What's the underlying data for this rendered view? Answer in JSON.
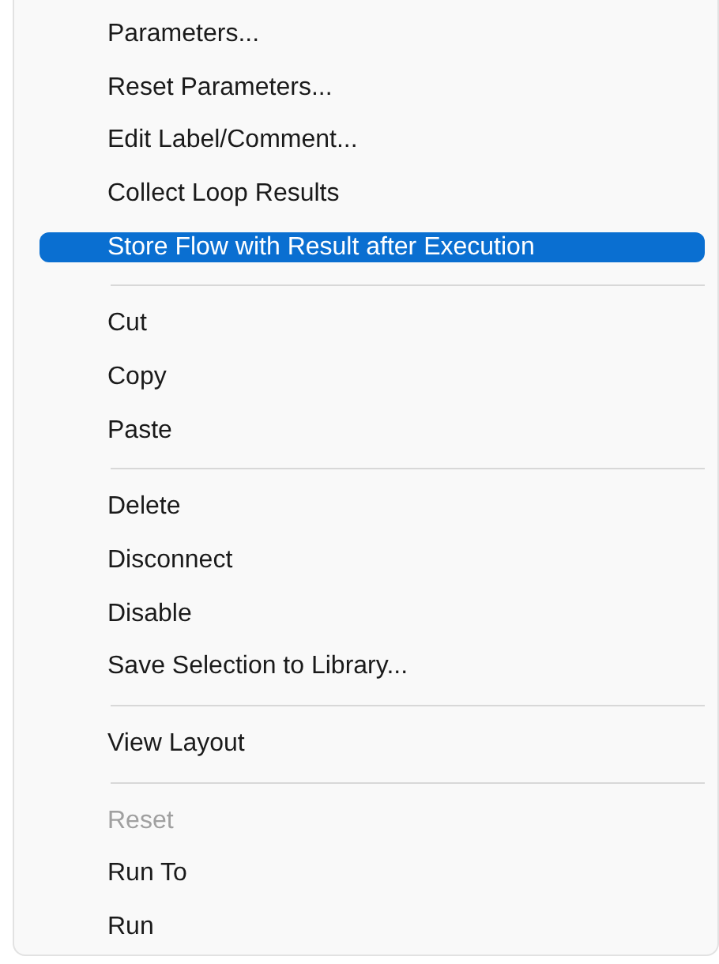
{
  "context_menu": {
    "groups": [
      {
        "items": [
          {
            "label": "Parameters...",
            "selected": false,
            "disabled": false
          },
          {
            "label": "Reset Parameters...",
            "selected": false,
            "disabled": false
          },
          {
            "label": "Edit Label/Comment...",
            "selected": false,
            "disabled": false
          },
          {
            "label": "Collect Loop Results",
            "selected": false,
            "disabled": false
          },
          {
            "label": "Store Flow with Result after Execution",
            "selected": true,
            "disabled": false
          }
        ]
      },
      {
        "items": [
          {
            "label": "Cut",
            "selected": false,
            "disabled": false
          },
          {
            "label": "Copy",
            "selected": false,
            "disabled": false
          },
          {
            "label": "Paste",
            "selected": false,
            "disabled": false
          }
        ]
      },
      {
        "items": [
          {
            "label": "Delete",
            "selected": false,
            "disabled": false
          },
          {
            "label": "Disconnect",
            "selected": false,
            "disabled": false
          },
          {
            "label": "Disable",
            "selected": false,
            "disabled": false
          },
          {
            "label": "Save Selection to Library...",
            "selected": false,
            "disabled": false
          }
        ]
      },
      {
        "items": [
          {
            "label": "View Layout",
            "selected": false,
            "disabled": false
          }
        ]
      },
      {
        "items": [
          {
            "label": "Reset",
            "selected": false,
            "disabled": true
          },
          {
            "label": "Run To",
            "selected": false,
            "disabled": false
          },
          {
            "label": "Run",
            "selected": false,
            "disabled": false
          }
        ]
      }
    ]
  }
}
